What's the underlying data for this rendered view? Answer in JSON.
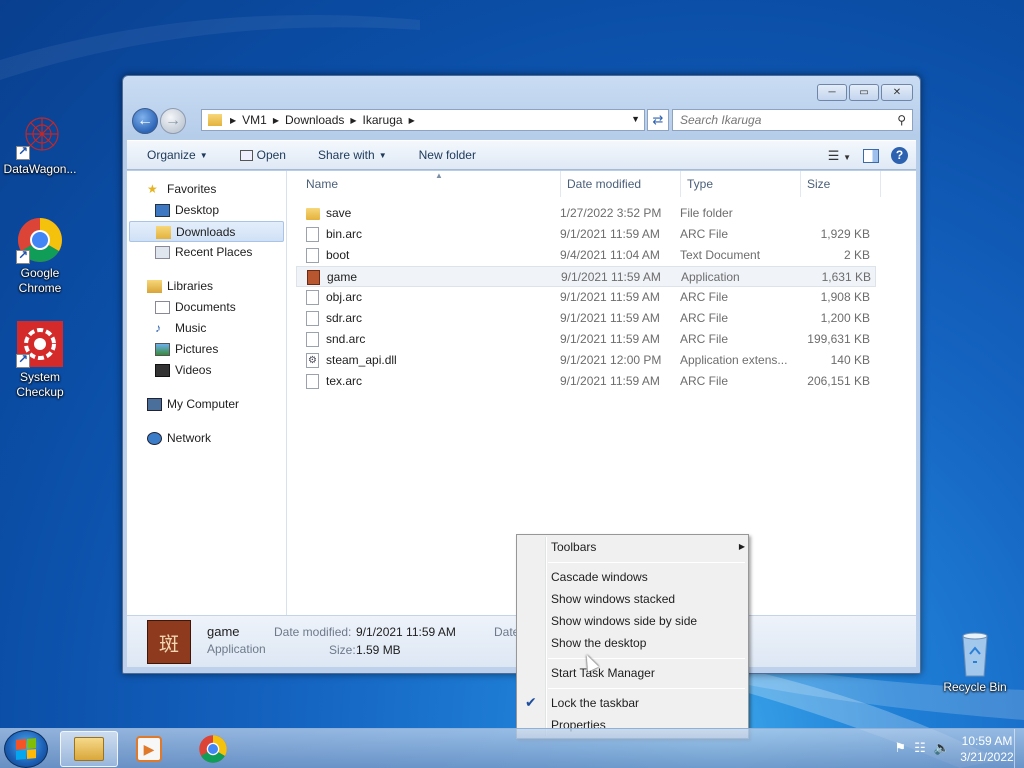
{
  "desktop": {
    "icons": [
      {
        "label": "DataWagon...",
        "icon": "datawagon-icon"
      },
      {
        "label": "Google Chrome",
        "icon": "chrome-icon"
      },
      {
        "label": "System Checkup",
        "icon": "system-checkup-icon"
      },
      {
        "label": "Recycle Bin",
        "icon": "recycle-bin-icon"
      }
    ]
  },
  "window": {
    "breadcrumbs": [
      "VM1",
      "Downloads",
      "Ikaruga"
    ],
    "search_placeholder": "Search Ikaruga",
    "toolbar": {
      "organize": "Organize",
      "open": "Open",
      "share_with": "Share with",
      "new_folder": "New folder"
    },
    "nav": {
      "favorites": "Favorites",
      "desktop": "Desktop",
      "downloads": "Downloads",
      "recent_places": "Recent Places",
      "libraries": "Libraries",
      "documents": "Documents",
      "music": "Music",
      "pictures": "Pictures",
      "videos": "Videos",
      "my_computer": "My Computer",
      "network": "Network"
    },
    "columns": {
      "name": "Name",
      "date_modified": "Date modified",
      "type": "Type",
      "size": "Size"
    },
    "files": [
      {
        "name": "save",
        "date": "1/27/2022 3:52 PM",
        "type": "File folder",
        "size": "",
        "icon": "folder"
      },
      {
        "name": "bin.arc",
        "date": "9/1/2021 11:59 AM",
        "type": "ARC File",
        "size": "1,929 KB",
        "icon": "doc"
      },
      {
        "name": "boot",
        "date": "9/4/2021 11:04 AM",
        "type": "Text Document",
        "size": "2 KB",
        "icon": "doc"
      },
      {
        "name": "game",
        "date": "9/1/2021 11:59 AM",
        "type": "Application",
        "size": "1,631 KB",
        "icon": "app"
      },
      {
        "name": "obj.arc",
        "date": "9/1/2021 11:59 AM",
        "type": "ARC File",
        "size": "1,908 KB",
        "icon": "doc"
      },
      {
        "name": "sdr.arc",
        "date": "9/1/2021 11:59 AM",
        "type": "ARC File",
        "size": "1,200 KB",
        "icon": "doc"
      },
      {
        "name": "snd.arc",
        "date": "9/1/2021 11:59 AM",
        "type": "ARC File",
        "size": "199,631 KB",
        "icon": "doc"
      },
      {
        "name": "steam_api.dll",
        "date": "9/1/2021 12:00 PM",
        "type": "Application extens...",
        "size": "140 KB",
        "icon": "dll"
      },
      {
        "name": "tex.arc",
        "date": "9/1/2021 11:59 AM",
        "type": "ARC File",
        "size": "206,151 KB",
        "icon": "doc"
      }
    ],
    "details": {
      "name": "game",
      "type": "Application",
      "date_label": "Date modified:",
      "date_value": "9/1/2021 11:59 AM",
      "size_label": "Size:",
      "size_value": "1.59 MB",
      "date_label2": "Date"
    }
  },
  "context_menu": {
    "toolbars": "Toolbars",
    "cascade": "Cascade windows",
    "stacked": "Show windows stacked",
    "side_by_side": "Show windows side by side",
    "show_desktop": "Show the desktop",
    "task_manager": "Start Task Manager",
    "lock_taskbar": "Lock the taskbar",
    "lock_checked": true,
    "properties": "Properties"
  },
  "taskbar": {
    "time": "10:59 AM",
    "date": "3/21/2022"
  },
  "colors": {
    "desktop_blue": "#1565c2",
    "selection": "#d0e1f6"
  }
}
